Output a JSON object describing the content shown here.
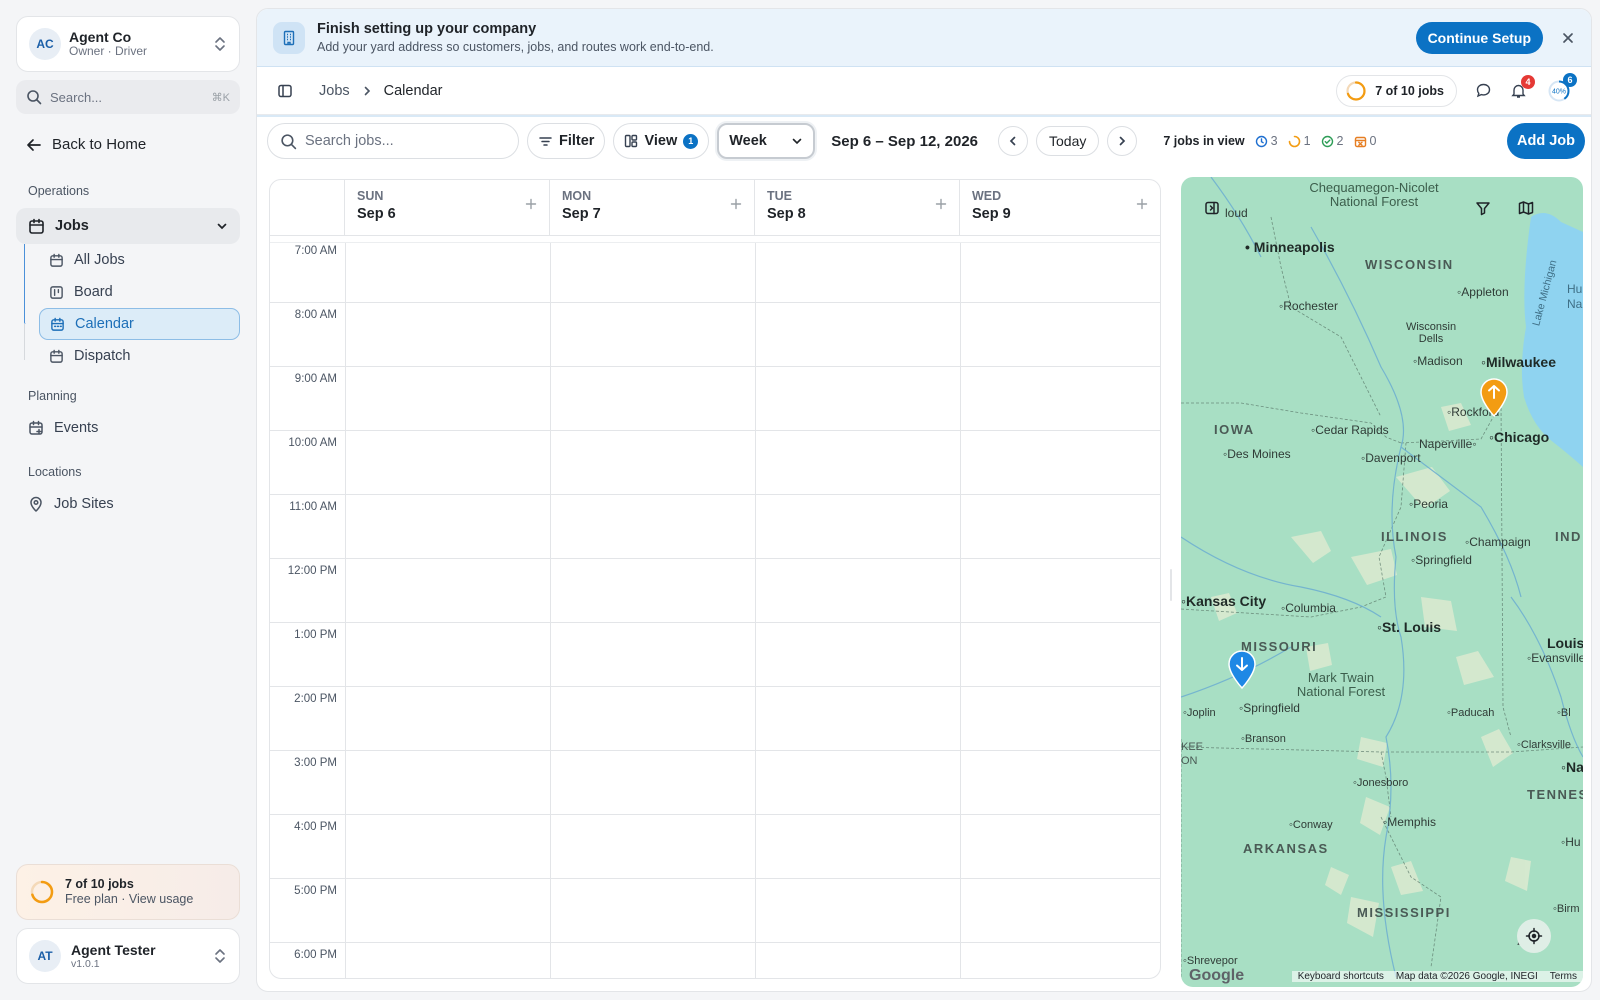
{
  "org": {
    "initials": "AC",
    "name": "Agent Co",
    "role": "Owner · Driver"
  },
  "sidebar": {
    "search_placeholder": "Search...",
    "search_shortcut": "⌘K",
    "back_label": "Back to Home",
    "sections": {
      "operations": "Operations",
      "planning": "Planning",
      "locations": "Locations"
    },
    "jobs_label": "Jobs",
    "subitems": [
      "All Jobs",
      "Board",
      "Calendar",
      "Dispatch"
    ],
    "events_label": "Events",
    "job_sites_label": "Job Sites",
    "usage_title": "7 of 10 jobs",
    "usage_sub": "Free plan · View usage",
    "usage_progress": 0.7,
    "user_initials": "AT",
    "user_name": "Agent Tester",
    "version": "v1.0.1"
  },
  "banner": {
    "title": "Finish setting up your company",
    "subtitle": "Add your yard address so customers, jobs, and routes work end-to-end.",
    "cta": "Continue Setup"
  },
  "header": {
    "breadcrumb": [
      "Jobs",
      "Calendar"
    ],
    "jobs_pill": "7 of 10 jobs",
    "notif_count": "4",
    "progress_badge": "6",
    "progress_text": "40%"
  },
  "toolbar": {
    "search_placeholder": "Search jobs...",
    "filter_label": "Filter",
    "view_label": "View",
    "view_count": "1",
    "range_select": "Week",
    "date_range": "Sep 6 – Sep 12, 2026",
    "today_label": "Today",
    "jobs_in_view": "7 jobs in view",
    "stat_scheduled": "3",
    "stat_in_progress": "1",
    "stat_completed": "2",
    "stat_cancelled": "0",
    "add_job": "Add Job"
  },
  "calendar": {
    "days": [
      {
        "dow": "SUN",
        "date": "Sep 6"
      },
      {
        "dow": "MON",
        "date": "Sep 7"
      },
      {
        "dow": "TUE",
        "date": "Sep 8"
      },
      {
        "dow": "WED",
        "date": "Sep 9"
      }
    ],
    "times": [
      "7:00 AM",
      "8:00 AM",
      "9:00 AM",
      "10:00 AM",
      "11:00 AM",
      "12:00 PM",
      "1:00 PM",
      "2:00 PM",
      "3:00 PM",
      "4:00 PM",
      "5:00 PM",
      "6:00 PM"
    ]
  },
  "map": {
    "labels": {
      "forest1": "Chequamegon-Nicolet National Forest",
      "cloud": "loud",
      "minneapolis": "Minneapolis",
      "wisconsin": "WISCONSIN",
      "rochester": "Rochester",
      "wisdells": "Wisconsin Dells",
      "appleton": "Appleton",
      "lakemich": "Lake Michigan",
      "hu": "Hu",
      "na": "Na",
      "madison": "Madison",
      "milwaukee": "Milwaukee",
      "rockford": "Rockford",
      "iowa": "IOWA",
      "cedar": "Cedar Rapids",
      "naperville": "Naperville",
      "chicago": "Chicago",
      "desmoines": "Des Moines",
      "davenport": "Davenport",
      "peoria": "Peoria",
      "illinois": "ILLINOIS",
      "champaign": "Champaign",
      "ind": "IND",
      "springfieldil": "Springfield",
      "kc": "Kansas City",
      "columbia": "Columbia",
      "stl": "St. Louis",
      "louisv": "Louisv",
      "missouri": "MISSOURI",
      "evansville": "Evansville",
      "forest2": "Mark Twain National Forest",
      "springfieldmo": "Springfield",
      "joplin": "Joplin",
      "paducah": "Paducah",
      "bl": "Bl",
      "branson": "Branson",
      "kee": "KEE",
      "on": "ON",
      "clarksville": "Clarksville",
      "jonesboro": "Jonesboro",
      "nash": "Na",
      "tenn": "TENNESS",
      "conway": "Conway",
      "memphis": "Memphis",
      "hu2": "Hu",
      "arkansas": "ARKANSAS",
      "mississippi": "MISSISSIPPI",
      "birm": "Birm",
      "a": "A",
      "shreveport": "Shrevepor"
    },
    "google": "Google",
    "keyboard": "Keyboard shortcuts",
    "mapdata": "Map data ©2026 Google, INEGI",
    "terms": "Terms",
    "colors": {
      "pickup_pin": "#f39c12",
      "dropoff_pin": "#1e88e5"
    }
  }
}
